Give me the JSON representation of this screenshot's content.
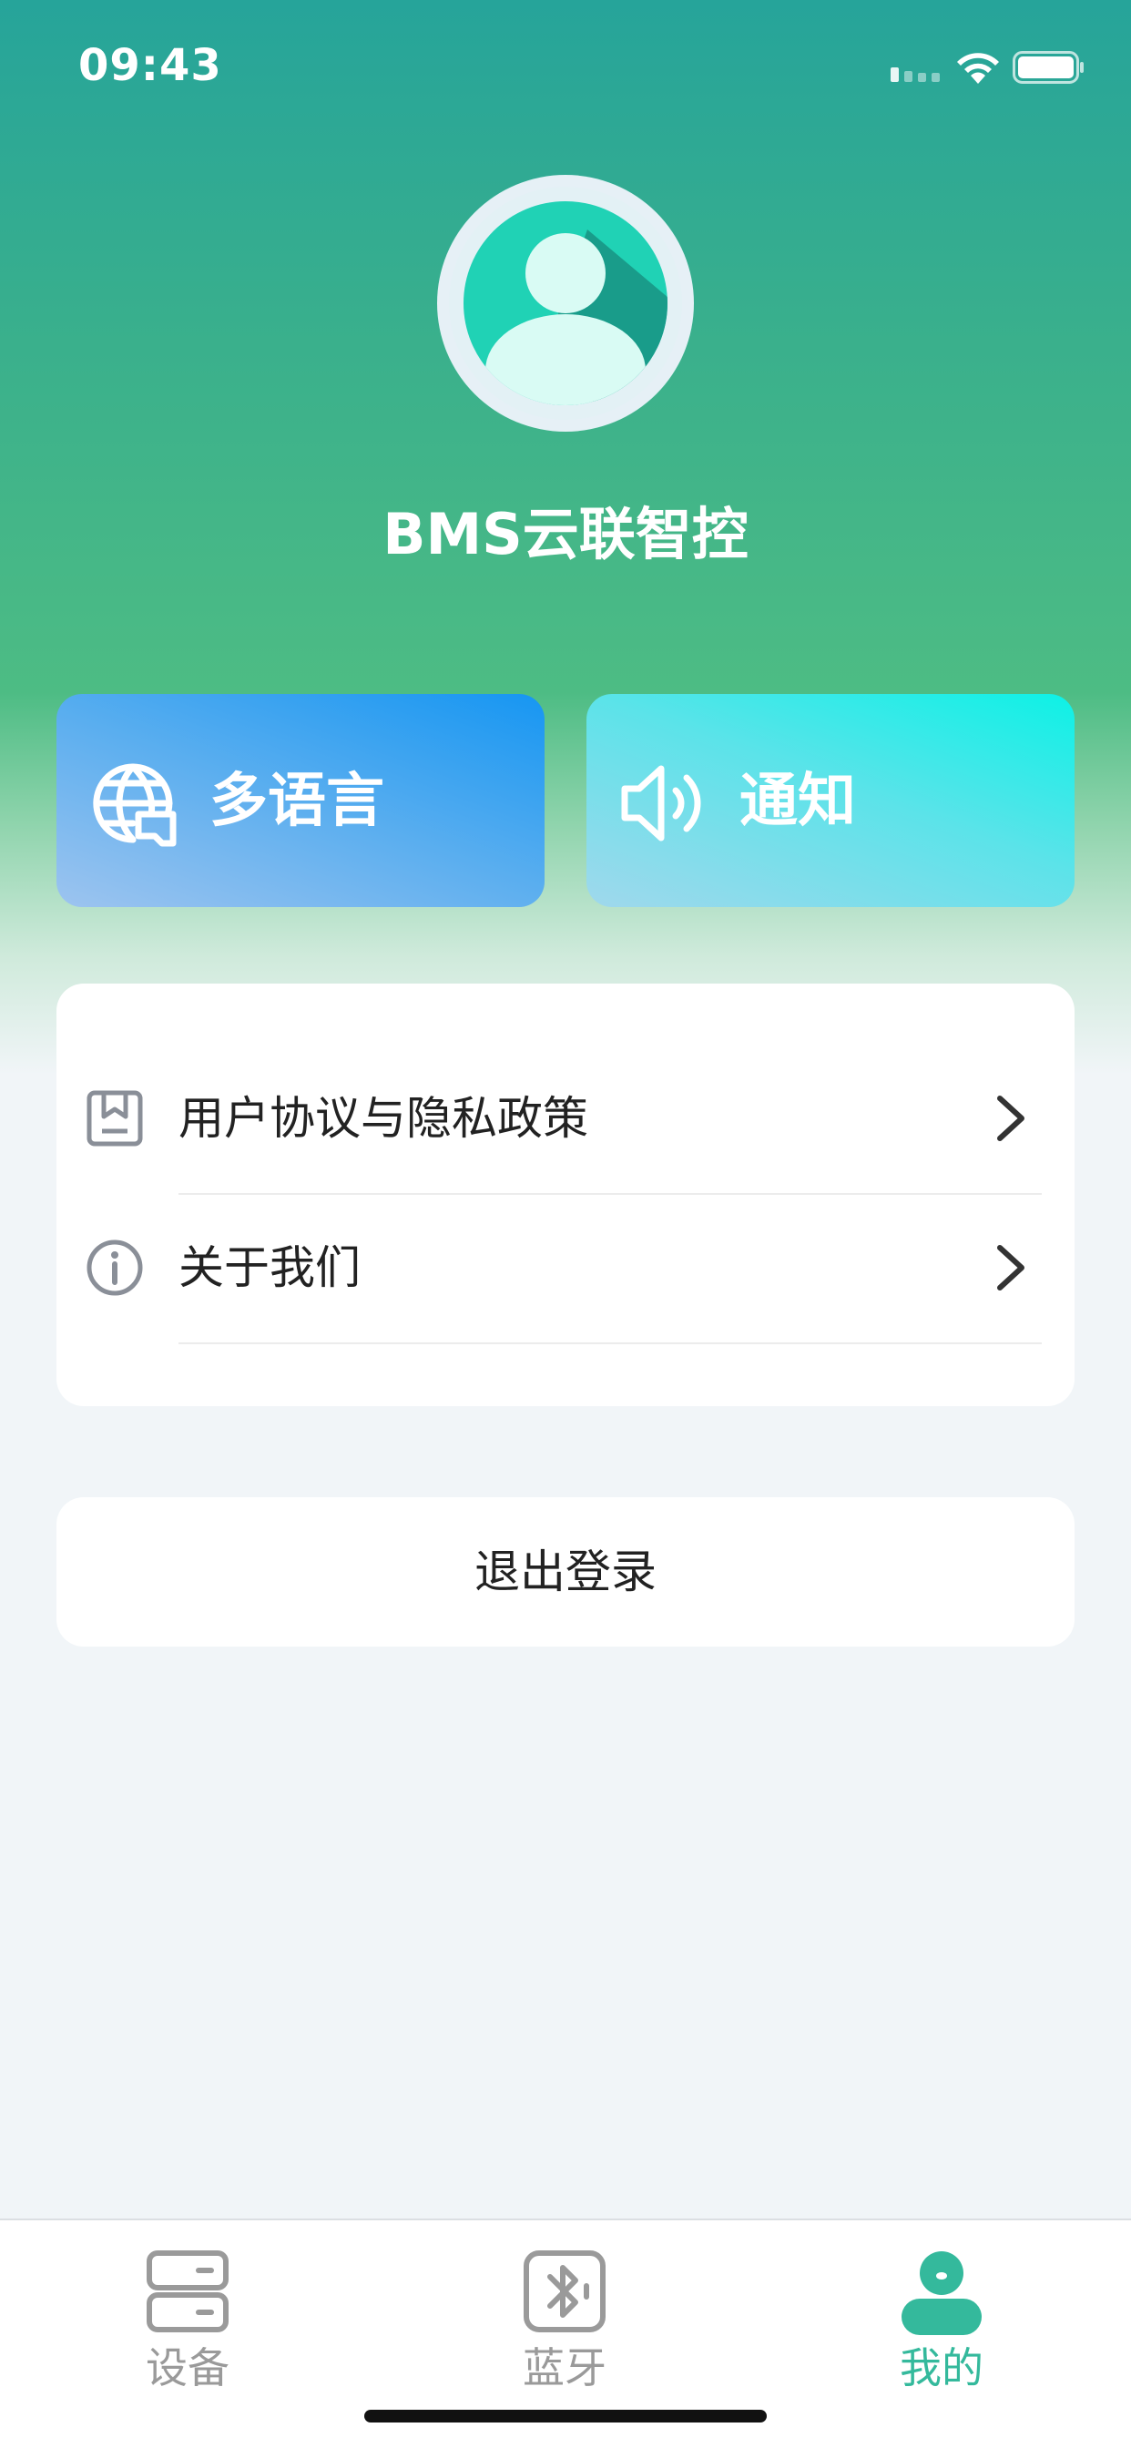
{
  "status_bar": {
    "time": "09:43"
  },
  "profile": {
    "app_title": "BMS云联智控"
  },
  "feature_cards": {
    "language_label": "多语言",
    "notice_label": "通知"
  },
  "menu": {
    "items": [
      {
        "label": "用户协议与隐私政策",
        "icon": "document-icon"
      },
      {
        "label": "关于我们",
        "icon": "info-icon"
      }
    ]
  },
  "logout": {
    "label": "退出登录"
  },
  "tab_bar": {
    "tabs": [
      {
        "label": "设备",
        "icon": "devices-icon",
        "active": false
      },
      {
        "label": "蓝牙",
        "icon": "bluetooth-icon",
        "active": false
      },
      {
        "label": "我的",
        "icon": "user-icon",
        "active": true
      }
    ]
  },
  "colors": {
    "accent": "#34b99c",
    "header_top": "#26a49a",
    "header_bottom": "#4dbc84",
    "background": "#f1f5f8",
    "language_card": "#1696f2",
    "notice_card": "#0df1e6"
  }
}
